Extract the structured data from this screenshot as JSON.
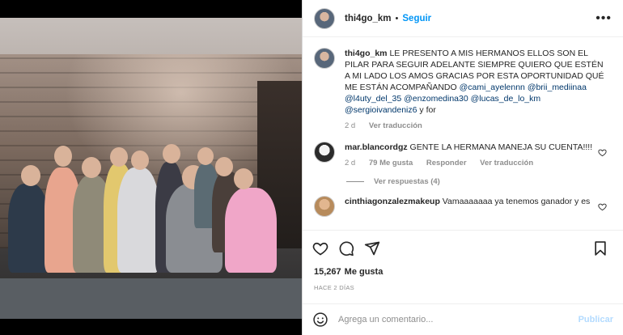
{
  "post": {
    "username": "thi4go_km",
    "follow_label": "Seguir",
    "separator": "•",
    "more_icon": "more-horizontal-icon"
  },
  "caption": {
    "username": "thi4go_km",
    "text": "LE PRESENTO A MIS HERMANOS ELLOS SON EL PILAR PARA SEGUIR ADELANTE SIEMPRE QUIERO QUE ESTÉN A MI LADO LOS AMOS GRACIAS POR ESTA OPORTUNIDAD QUÉ ME ESTÁN ACOMPAÑANDO",
    "mentions": [
      "@cami_ayelennn",
      "@brii_mediinaa",
      "@l4uty_del_35",
      "@enzomedina30",
      "@lucas_de_lo_km",
      "@sergioivandeniz6"
    ],
    "joiner": "y",
    "last_word": "for",
    "time": "2 d",
    "see_translation": "Ver traducción"
  },
  "comments": [
    {
      "username": "mar.blancordgz",
      "text": "GENTE LA HERMANA MANEJA SU CUENTA!!!!",
      "time": "2 d",
      "likes": "79 Me gusta",
      "reply": "Responder",
      "see_translation": "Ver traducción",
      "view_replies": "Ver respuestas (4)"
    },
    {
      "username": "cinthiagonzalezmakeup",
      "text": "Vamaaaaaaa ya tenemos ganador y es"
    }
  ],
  "actions": {
    "like_icon": "heart-icon",
    "comment_icon": "comment-icon",
    "share_icon": "send-icon",
    "save_icon": "bookmark-icon"
  },
  "likes": {
    "count": "15,267",
    "label": "Me gusta"
  },
  "time_ago": "HACE 2 DÍAS",
  "add_comment": {
    "placeholder": "Agrega un comentario...",
    "publish_label": "Publicar",
    "emoji_icon": "emoji-icon"
  },
  "colors": {
    "link": "#0095f6",
    "mention": "#00376b",
    "publish_disabled": "#b3dbff"
  }
}
